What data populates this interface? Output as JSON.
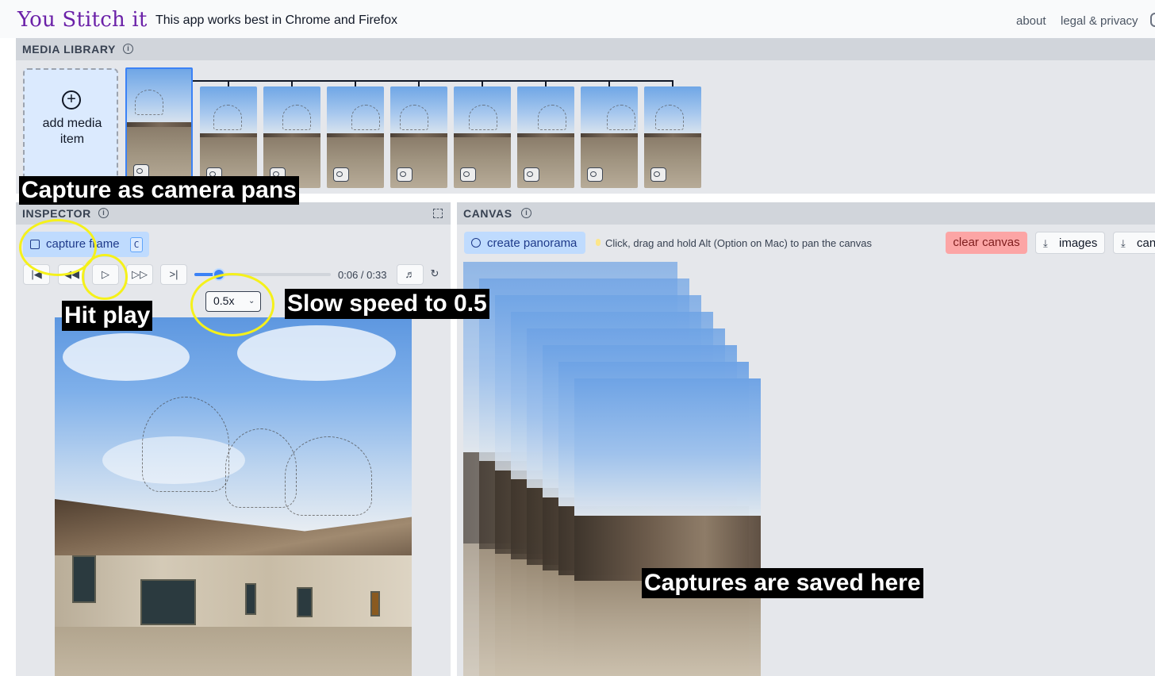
{
  "header": {
    "brand": "You Stitch it",
    "notice": "This app works best in Chrome and Firefox",
    "nav": {
      "about": "about",
      "legal": "legal & privacy"
    }
  },
  "library": {
    "title": "MEDIA LIBRARY",
    "info_icon": "info-icon",
    "add_label": "add media item",
    "add_icon": "plus-circle-icon",
    "items": [
      {
        "kind": "video",
        "icon": "video-icon",
        "selected": true
      },
      {
        "kind": "image",
        "icon": "image-icon"
      },
      {
        "kind": "image",
        "icon": "image-icon"
      },
      {
        "kind": "image",
        "icon": "image-icon"
      },
      {
        "kind": "image",
        "icon": "image-icon"
      },
      {
        "kind": "image",
        "icon": "image-icon"
      },
      {
        "kind": "image",
        "icon": "image-icon"
      },
      {
        "kind": "image",
        "icon": "image-icon"
      },
      {
        "kind": "image",
        "icon": "image-icon"
      }
    ]
  },
  "inspector": {
    "title": "INSPECTOR",
    "capture_label": "capture frame",
    "capture_shortcut": "C",
    "player": {
      "buttons": [
        "skip-to-start-icon",
        "rewind-icon",
        "play-icon",
        "fast-forward-icon",
        "skip-to-end-icon"
      ],
      "progress_fraction": 0.18,
      "time": "0:06 / 0:33",
      "speed": "0.5x",
      "volume_icon": "volume-icon",
      "loop_icon": "loop-icon"
    }
  },
  "canvas": {
    "title": "CANVAS",
    "create_panorama": "create panorama",
    "hint": "Click, drag and hold Alt (Option on Mac) to pan the canvas",
    "clear": "clear canvas",
    "images": "images",
    "can": "can",
    "colors": {
      "clear_bg": "#fca5a5",
      "primary_bg": "#bfdbfe"
    }
  },
  "annotations": {
    "capture_pans": "Capture as camera pans",
    "hit_play": "Hit play",
    "slow_speed": "Slow speed to 0.5",
    "captures_saved": "Captures are saved here",
    "highlight_color": "#f5f11a"
  }
}
